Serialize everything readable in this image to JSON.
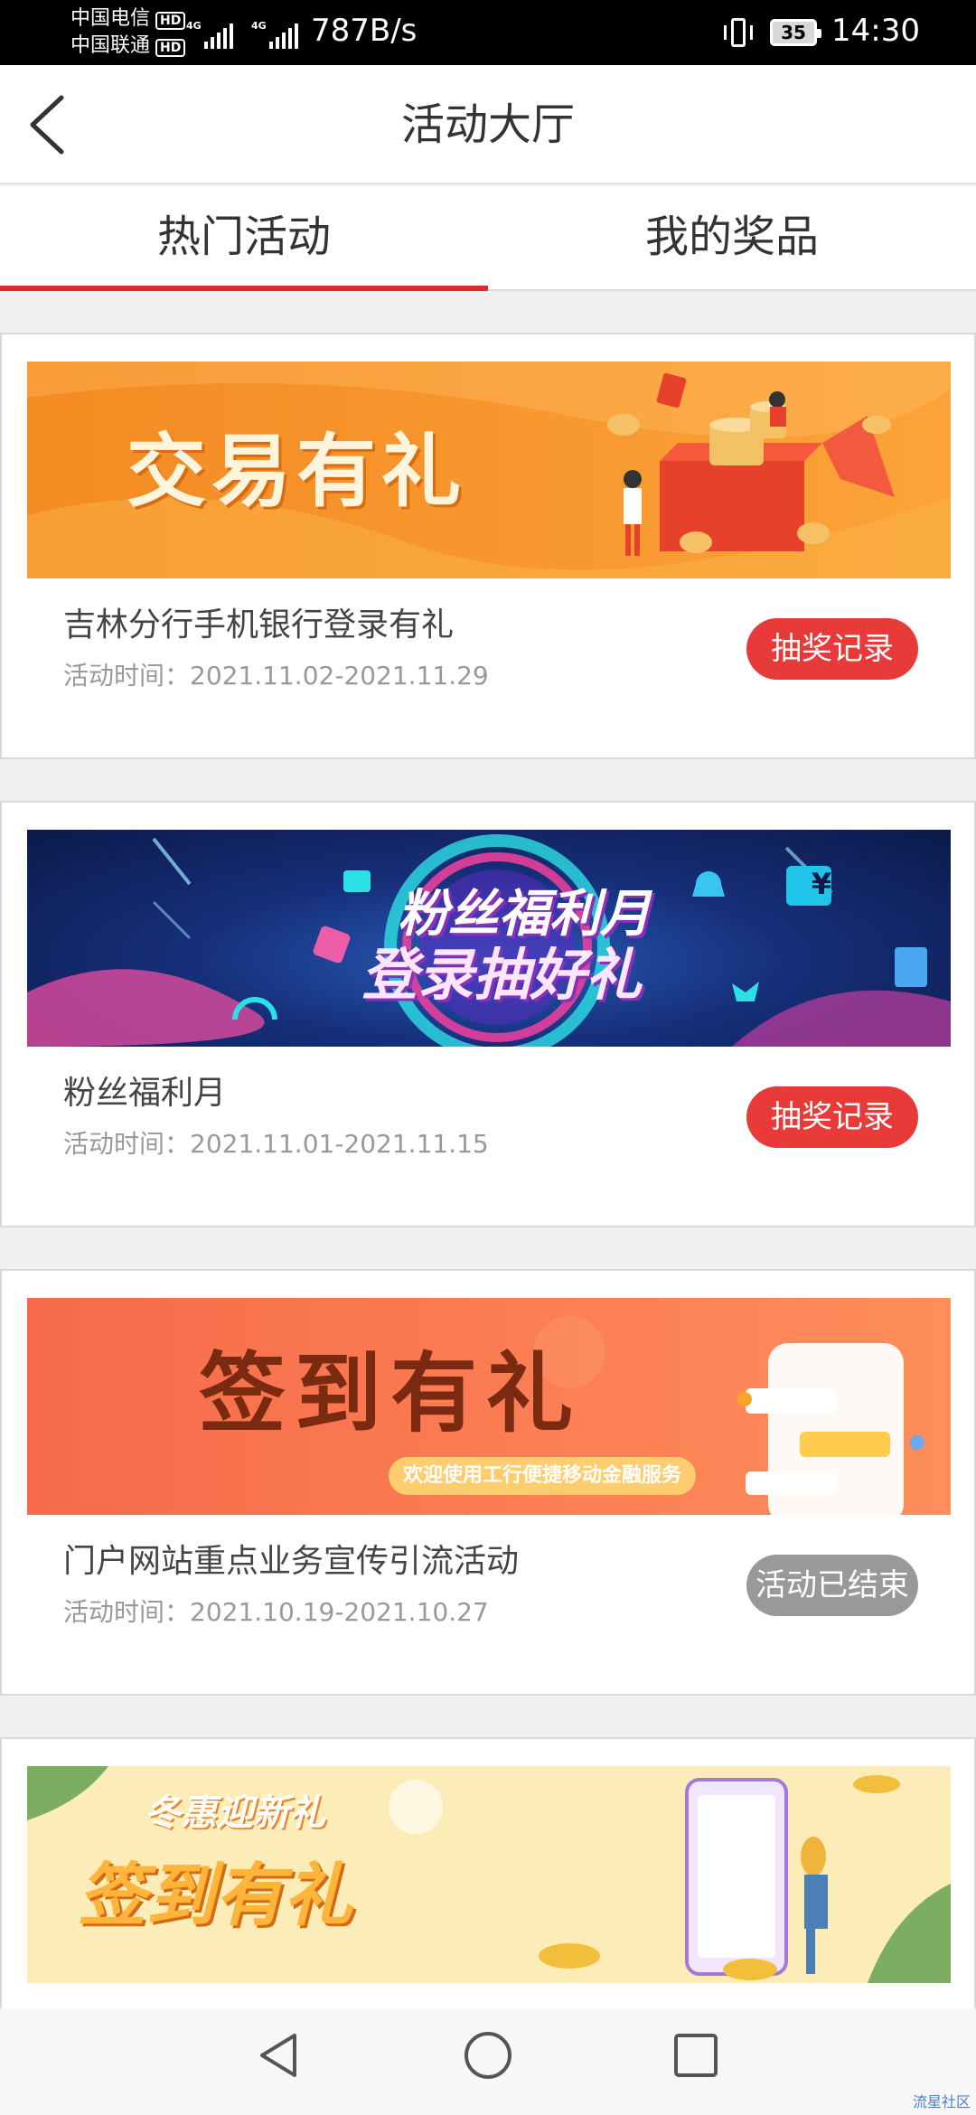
{
  "status_bar": {
    "carrier_1": "中国电信",
    "carrier_2": "中国联通",
    "hd_badge": "HD",
    "network_1": "4G",
    "network_2": "4G",
    "net_speed": "787B/s",
    "battery": "35",
    "time": "14:30"
  },
  "header": {
    "title": "活动大厅"
  },
  "tabs": [
    {
      "label": "热门活动",
      "active": true
    },
    {
      "label": "我的奖品",
      "active": false
    }
  ],
  "activities": [
    {
      "banner_text": "交易有礼",
      "title": "吉林分行手机银行登录有礼",
      "time": "活动时间：2021.11.02-2021.11.29",
      "button": "抽奖记录",
      "button_style": "active"
    },
    {
      "banner_text_1": "粉丝福利月",
      "banner_text_2": "登录抽好礼",
      "title": "粉丝福利月",
      "time": "活动时间：2021.11.01-2021.11.15",
      "button": "抽奖记录",
      "button_style": "active",
      "banner_currency": "¥"
    },
    {
      "banner_text": "签到有礼",
      "banner_subtext": "欢迎使用工行便捷移动金融服务",
      "title": "门户网站重点业务宣传引流活动",
      "time": "活动时间：2021.10.19-2021.10.27",
      "button": "活动已结束",
      "button_style": "ended"
    },
    {
      "banner_text_1": "冬惠迎新礼",
      "banner_text_2": "签到有礼"
    }
  ],
  "watermark": "流星社区",
  "colors": {
    "accent": "#e0292c",
    "button_active": "#e93a3a",
    "button_ended": "#999999"
  }
}
